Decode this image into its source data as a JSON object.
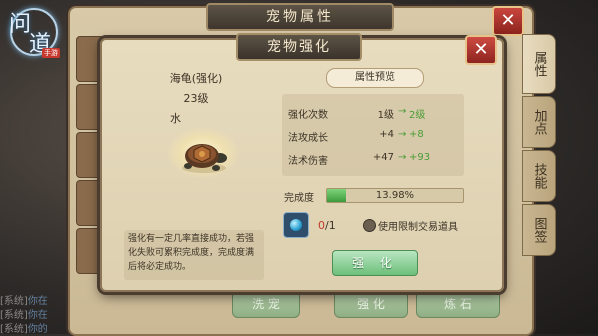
{
  "logo": {
    "glyph_1": "问",
    "glyph_2": "道",
    "tag": "手游"
  },
  "back_panel": {
    "title": "宠物属性",
    "close_icon": "close-icon",
    "side_tabs": [
      {
        "label": "属性",
        "active": true
      },
      {
        "label": "加点",
        "active": false
      },
      {
        "label": "技能",
        "active": false
      },
      {
        "label": "图签",
        "active": false
      }
    ],
    "bottom_buttons": [
      "洗  宠",
      "强  化",
      "炼  石"
    ],
    "chat_lines": [
      {
        "prefix": "[系统]",
        "text": "你在"
      },
      {
        "prefix": "[系统]",
        "text": "你在"
      },
      {
        "prefix": "[系统]",
        "text": "你的"
      }
    ]
  },
  "modal": {
    "title": "宠物强化",
    "close_icon": "close-icon",
    "pet": {
      "name": "海龟(强化)",
      "level": "23级",
      "element": "水",
      "image_icon": "turtle-icon"
    },
    "preview_label": "属性预览",
    "stats": [
      {
        "label": "强化次数",
        "from": "1级",
        "to": "2级"
      },
      {
        "label": "法攻成长",
        "from": "+4",
        "to": "+8"
      },
      {
        "label": "法术伤害",
        "from": "+47",
        "to": "+93"
      }
    ],
    "progress": {
      "label": "完成度",
      "percent": 13.98,
      "text": "13.98%"
    },
    "item": {
      "icon": "gem-icon",
      "have": "0",
      "need": "/1"
    },
    "checkbox_label": "使用限制交易道具",
    "description": "强化有一定几率直接成功，若强化失败可累积完成度，完成度满后将必定成功。",
    "enhance_button": "强  化"
  }
}
